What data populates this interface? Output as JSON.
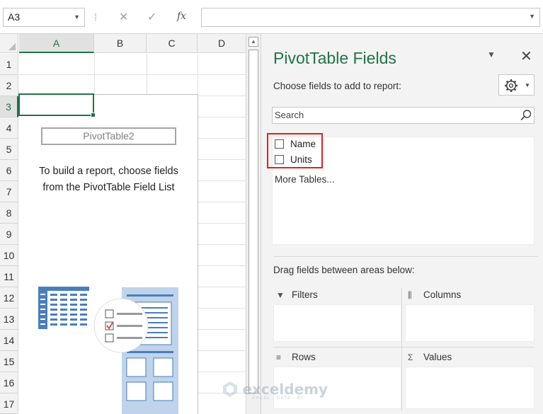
{
  "formula_bar": {
    "name_box": "A3",
    "cancel_icon": "✕",
    "enter_icon": "✓",
    "fx_label": "fx",
    "formula_value": ""
  },
  "grid": {
    "columns": [
      "A",
      "B",
      "C",
      "D"
    ],
    "rows": [
      "1",
      "2",
      "3",
      "4",
      "5",
      "6",
      "7",
      "8",
      "9",
      "10",
      "11",
      "12",
      "13",
      "14",
      "15",
      "16",
      "17"
    ],
    "selected_column": "A",
    "selected_row": "3",
    "pivot_name": "PivotTable2",
    "pivot_instruction_line1": "To build a report, choose fields",
    "pivot_instruction_line2": "from the PivotTable Field List"
  },
  "pane": {
    "title": "PivotTable Fields",
    "subtitle": "Choose fields to add to report:",
    "search_placeholder": "Search",
    "fields": [
      {
        "label": "Name",
        "checked": false
      },
      {
        "label": "Units",
        "checked": false
      }
    ],
    "more_tables": "More Tables...",
    "drag_label": "Drag fields between areas below:",
    "areas": {
      "filters": "Filters",
      "columns": "Columns",
      "rows": "Rows",
      "values": "Values"
    },
    "accent_color": "#217346",
    "highlight_color": "#e02020"
  },
  "watermark": {
    "name": "exceldemy",
    "tagline": "EXCEL · DATA · BI"
  }
}
